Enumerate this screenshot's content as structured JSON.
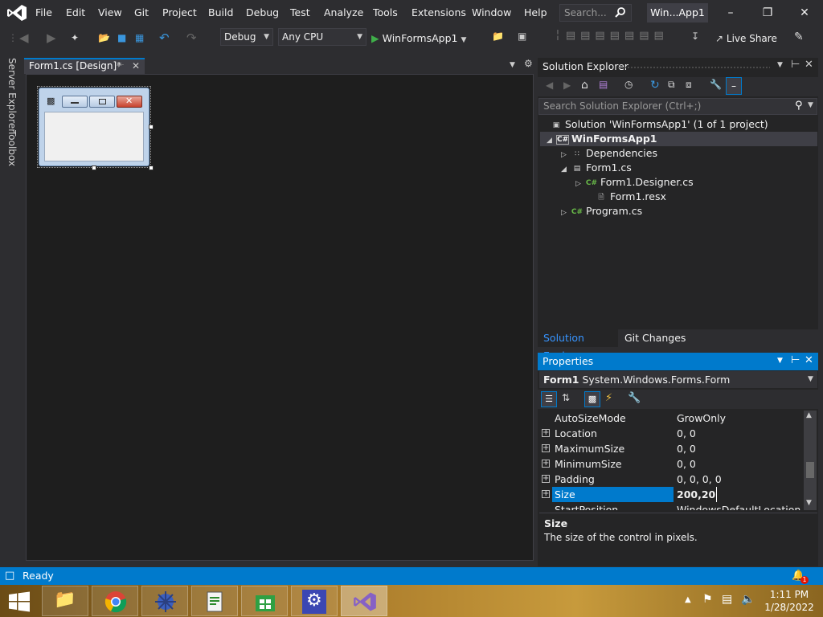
{
  "menu": {
    "items": [
      "File",
      "Edit",
      "View",
      "Git",
      "Project",
      "Build",
      "Debug",
      "Test",
      "Analyze",
      "Tools",
      "Extensions",
      "Window",
      "Help"
    ],
    "search_placeholder": "Search...",
    "window_title": "Win...App1"
  },
  "toolbar": {
    "config": "Debug",
    "platform": "Any CPU",
    "start_target": "WinFormsApp1",
    "live_share": "Live Share"
  },
  "side_tabs": {
    "server_explorer": "Server Explorer",
    "toolbox": "Toolbox"
  },
  "document": {
    "tab_title": "Form1.cs [Design]*"
  },
  "solution_explorer": {
    "title": "Solution Explorer",
    "search_placeholder": "Search Solution Explorer (Ctrl+;)",
    "tree": [
      {
        "label": "Solution 'WinFormsApp1' (1 of 1 project)",
        "icon": "solution-icon"
      },
      {
        "label": "WinFormsApp1",
        "icon": "csharp-project-icon"
      },
      {
        "label": "Dependencies",
        "icon": "dependencies-icon"
      },
      {
        "label": "Form1.cs",
        "icon": "form-icon"
      },
      {
        "label": "Form1.Designer.cs",
        "icon": "csharp-file-icon"
      },
      {
        "label": "Form1.resx",
        "icon": "resx-file-icon"
      },
      {
        "label": "Program.cs",
        "icon": "csharp-file-icon"
      }
    ],
    "bottom_tabs": [
      "Solution Explorer",
      "Git Changes"
    ]
  },
  "properties": {
    "title": "Properties",
    "object_name": "Form1",
    "object_type": "System.Windows.Forms.Form",
    "rows": [
      {
        "name": "AutoSizeMode",
        "value": "GrowOnly"
      },
      {
        "name": "Location",
        "value": "0, 0"
      },
      {
        "name": "MaximumSize",
        "value": "0, 0"
      },
      {
        "name": "MinimumSize",
        "value": "0, 0"
      },
      {
        "name": "Padding",
        "value": "0, 0, 0, 0"
      },
      {
        "name": "Size",
        "value": "200,20"
      },
      {
        "name": "StartPosition",
        "value": "WindowsDefaultLocation"
      }
    ],
    "description_title": "Size",
    "description_text": "The size of the control in pixels."
  },
  "status": {
    "text": "Ready",
    "notification_count": "1"
  },
  "taskbar": {
    "apps": [
      "file-explorer-icon",
      "chrome-icon",
      "network-icon",
      "notepad-icon",
      "store-icon",
      "settings-icon",
      "visual-studio-icon"
    ],
    "time": "1:11 PM",
    "date": "1/28/2022"
  },
  "colors": {
    "accent": "#007acc",
    "background": "#2d2d30",
    "designer_bg": "#1e1e1e"
  }
}
